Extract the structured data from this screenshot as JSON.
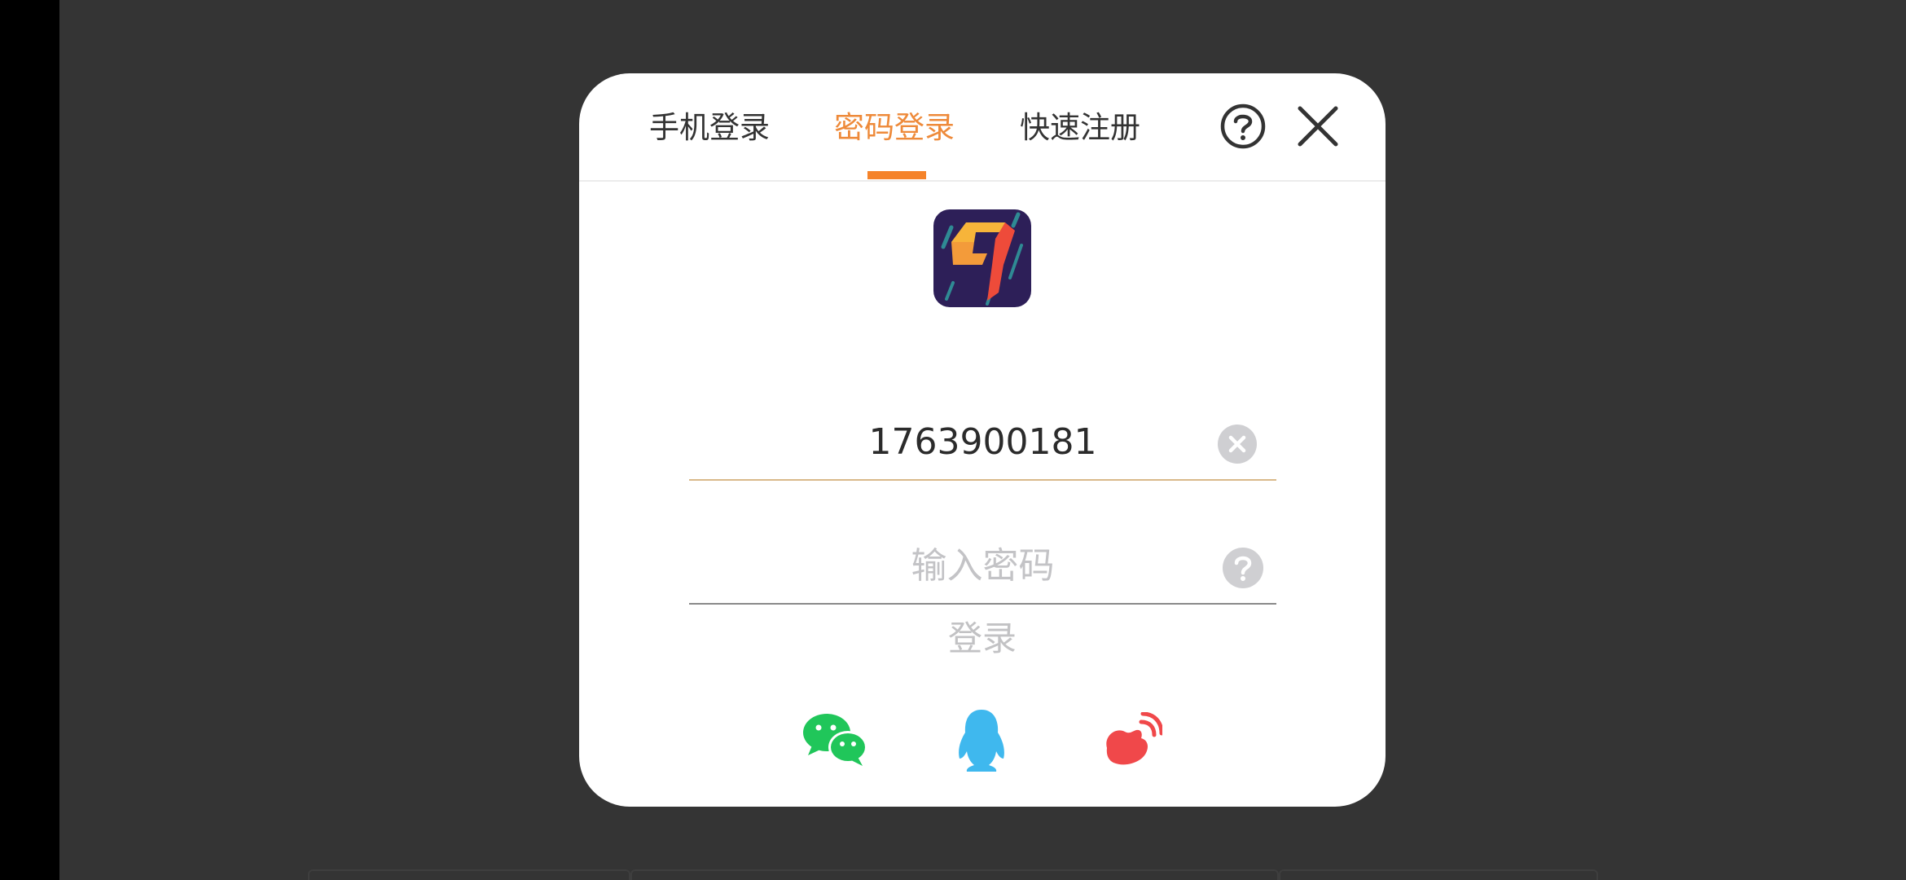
{
  "colors": {
    "accent": "#f5832a",
    "tab_active_text": "#ee8a3a",
    "wechat": "#20c65a",
    "qq": "#3fb8ee",
    "weibo": "#f0484a"
  },
  "tabs": [
    {
      "label": "手机登录",
      "active": false
    },
    {
      "label": "密码登录",
      "active": true
    },
    {
      "label": "快速注册",
      "active": false
    }
  ],
  "header_icons": {
    "help": "help-circle-icon",
    "close": "close-icon"
  },
  "form": {
    "account_value": "1763900181",
    "password_placeholder": "输入密码",
    "login_label": "登录"
  },
  "social_logins": [
    {
      "name": "wechat",
      "icon": "wechat-icon"
    },
    {
      "name": "qq",
      "icon": "qq-icon"
    },
    {
      "name": "weibo",
      "icon": "weibo-icon"
    }
  ]
}
